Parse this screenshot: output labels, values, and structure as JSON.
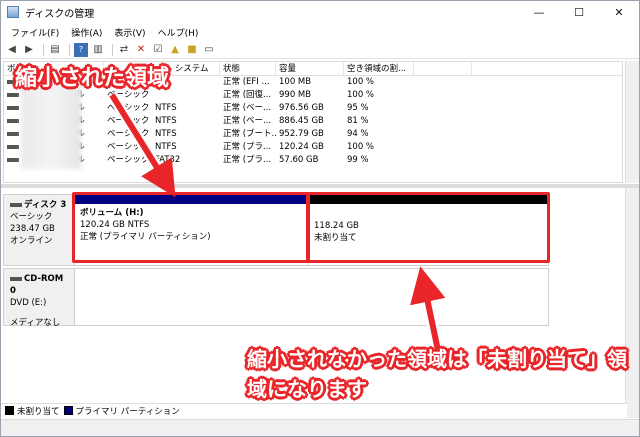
{
  "window": {
    "title": "ディスクの管理",
    "buttons": [
      "—",
      "☐",
      "✕"
    ]
  },
  "menu": [
    "ファイル(F)",
    "操作(A)",
    "表示(V)",
    "ヘルプ(H)"
  ],
  "toolbar_icons": [
    "back-icon",
    "forward-icon",
    "panel-icon",
    "help-icon",
    "panel2-icon",
    "connect-icon",
    "delete-icon",
    "check-icon",
    "folder-up-icon",
    "folder-icon",
    "panel3-icon"
  ],
  "columns": [
    "ボ",
    "",
    "",
    "イル システム",
    "状態",
    "容量",
    "空き領域の割...",
    ""
  ],
  "volumes": [
    {
      "layout": "",
      "type": "",
      "fs": "",
      "status": "正常 (EFI ...",
      "capacity": "100 MB",
      "free_pct": "100 %"
    },
    {
      "layout": "シンプル",
      "type": "ベーシック",
      "fs": "",
      "status": "正常 (回復...",
      "capacity": "990 MB",
      "free_pct": "100 %"
    },
    {
      "layout": "シンプル",
      "type": "ベーシック",
      "fs": "NTFS",
      "status": "正常 (ベー...",
      "capacity": "976.56 GB",
      "free_pct": "95 %"
    },
    {
      "layout": "シンプル",
      "type": "ベーシック",
      "fs": "NTFS",
      "status": "正常 (ベー...",
      "capacity": "886.45 GB",
      "free_pct": "81 %"
    },
    {
      "layout": "シンプル",
      "type": "ベーシック",
      "fs": "NTFS",
      "status": "正常 (ブート...",
      "capacity": "952.79 GB",
      "free_pct": "94 %"
    },
    {
      "layout": "シンプル",
      "type": "ベーシック",
      "fs": "NTFS",
      "status": "正常 (プラ...",
      "capacity": "120.24 GB",
      "free_pct": "100 %"
    },
    {
      "layout": "シンプル",
      "type": "ベーシック",
      "fs": "FAT32",
      "status": "正常 (プラ...",
      "capacity": "57.60 GB",
      "free_pct": "99 %"
    }
  ],
  "disk3": {
    "name": "ディスク 3",
    "kind": "ベーシック",
    "size": "238.47 GB",
    "state": "オンライン",
    "volume": {
      "title": "ボリューム (H:)",
      "size": "120.24 GB NTFS",
      "status": "正常 (プライマリ パーティション)"
    },
    "unallocated": {
      "size": "118.24 GB",
      "label": "未割り当て"
    }
  },
  "cdrom": {
    "name": "CD-ROM 0",
    "drive": "DVD (E:)",
    "media": "メディアなし"
  },
  "legend": [
    {
      "label": "未割り当て",
      "color": "#000000"
    },
    {
      "label": "プライマリ パーティション",
      "color": "#000080"
    }
  ],
  "annotations": {
    "shrunk": "縮小された領域",
    "not_shrunk": "縮小されなかった領域は「未割り当て」領域になります"
  },
  "colors": {
    "accent": "#e8262a",
    "primary_partition": "#000080",
    "unallocated": "#000000"
  }
}
